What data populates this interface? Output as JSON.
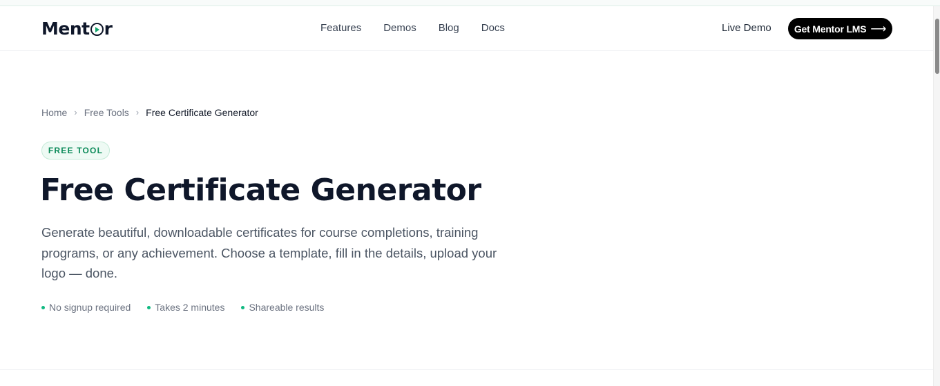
{
  "header": {
    "logo_left": "Ment",
    "logo_right": "r",
    "nav": [
      {
        "label": "Features"
      },
      {
        "label": "Demos"
      },
      {
        "label": "Blog"
      },
      {
        "label": "Docs"
      }
    ],
    "live_demo": "Live Demo",
    "cta_label": "Get Mentor LMS",
    "cta_arrow": "⟶"
  },
  "breadcrumb": {
    "items": [
      "Home",
      "Free Tools"
    ],
    "separator": "›",
    "current": "Free Certificate Generator"
  },
  "hero": {
    "badge": "FREE TOOL",
    "title": "Free Certificate Generator",
    "description": "Generate beautiful, downloadable certificates for course completions, training programs, or any achievement. Choose a template, fill in the details, upload your logo — done.",
    "features": [
      "No signup required",
      "Takes 2 minutes",
      "Shareable results"
    ]
  },
  "colors": {
    "accent": "#10b981",
    "badge_text": "#0b8a59",
    "cta_bg": "#000000",
    "title": "#0f172a"
  },
  "icons": {
    "logo_mark": "play-circle-icon",
    "breadcrumb_separator": "chevron-right-icon",
    "cta": "arrow-right-icon",
    "feature_bullet": "dot-icon"
  }
}
